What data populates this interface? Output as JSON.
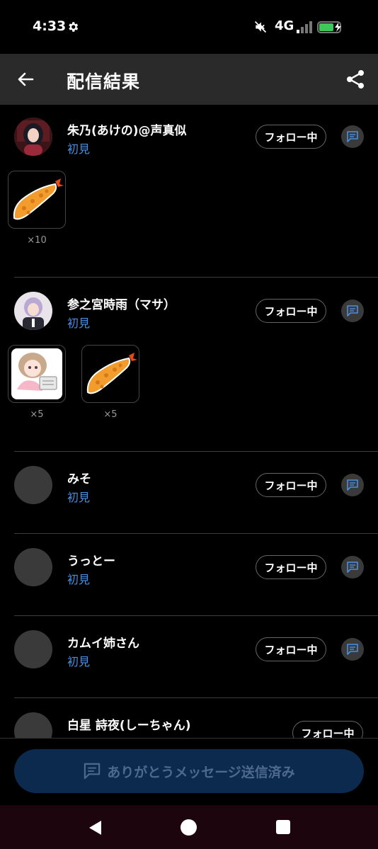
{
  "status_bar": {
    "time": "4:33",
    "network": "4G",
    "icons": [
      "gear-icon",
      "mute-icon",
      "signal-icon",
      "battery-charging-icon"
    ]
  },
  "app_bar": {
    "title": "配信結果",
    "icons": [
      "back-arrow-icon",
      "share-icon"
    ]
  },
  "entries": [
    {
      "name": "朱乃(あけの)@声真似",
      "tag": "初見",
      "follow_label": "フォロー中",
      "gifts": [
        {
          "icon": "fried-shrimp-icon",
          "count": "×10"
        }
      ]
    },
    {
      "name": "参之宮時雨（マサ）",
      "tag": "初見",
      "follow_label": "フォロー中",
      "gifts": [
        {
          "icon": "anime-girl-sticker-icon",
          "count": "×5"
        },
        {
          "icon": "fried-shrimp-icon",
          "count": "×5"
        }
      ]
    },
    {
      "name": "みそ",
      "tag": "初見",
      "follow_label": "フォロー中",
      "gifts": []
    },
    {
      "name": "うっとー",
      "tag": "初見",
      "follow_label": "フォロー中",
      "gifts": []
    },
    {
      "name": "カムイ姉さん",
      "tag": "初見",
      "follow_label": "フォロー中",
      "gifts": []
    },
    {
      "name": "白星 詩夜(しーちゃん)",
      "tag": "",
      "follow_label": "フォロー中",
      "gifts": []
    }
  ],
  "footer": {
    "thanks_button_label": "ありがとうメッセージ送信済み"
  },
  "colors": {
    "app_bar_bg": "#2a2a2a",
    "tag_blue": "#4a8fe0",
    "thanks_button_bg": "#0c2a4d",
    "thanks_button_text": "#4d6a8e"
  }
}
